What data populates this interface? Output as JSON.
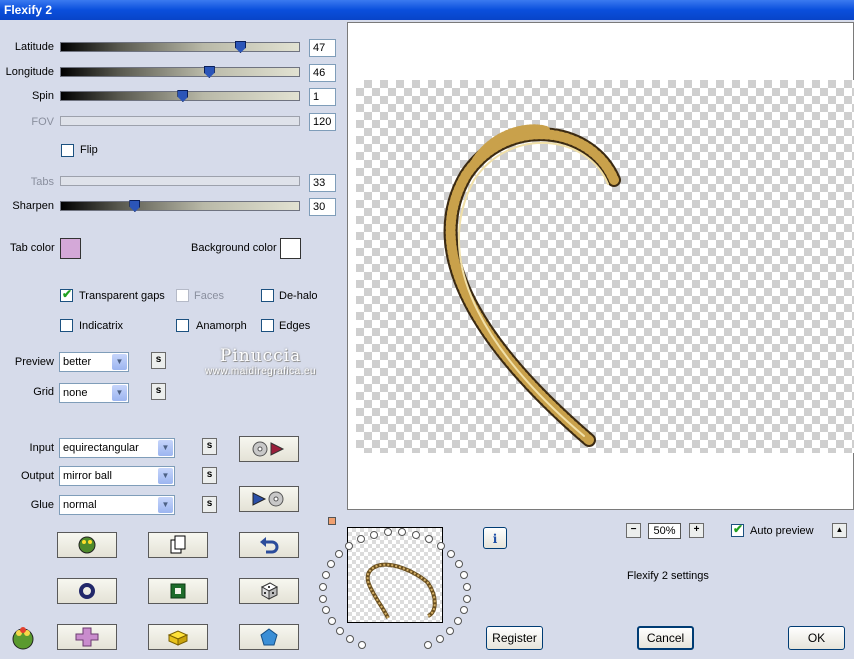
{
  "window": {
    "title": "Flexify 2"
  },
  "sliders": [
    {
      "label": "Latitude",
      "value": "47",
      "fraction": 0.75,
      "enabled": true
    },
    {
      "label": "Longitude",
      "value": "46",
      "fraction": 0.62,
      "enabled": true
    },
    {
      "label": "Spin",
      "value": "1",
      "fraction": 0.51,
      "enabled": true
    },
    {
      "label": "FOV",
      "value": "120",
      "enabled": false
    },
    {
      "label": "Tabs",
      "value": "33",
      "enabled": false
    },
    {
      "label": "Sharpen",
      "value": "30",
      "fraction": 0.31,
      "enabled": true
    }
  ],
  "flip": {
    "label": "Flip",
    "checked": false
  },
  "colors": {
    "tab_color_label": "Tab color",
    "tab_color": "#d4a8d8",
    "background_color_label": "Background color",
    "background_color": "#ffffff"
  },
  "options": {
    "transparent_gaps": {
      "label": "Transparent gaps",
      "checked": true
    },
    "faces": {
      "label": "Faces",
      "checked": false,
      "enabled": false
    },
    "de_halo": {
      "label": "De-halo",
      "checked": false
    },
    "indicatrix": {
      "label": "Indicatrix",
      "checked": false
    },
    "anamorph": {
      "label": "Anamorph",
      "checked": false
    },
    "edges": {
      "label": "Edges",
      "checked": false
    }
  },
  "preview_quality": {
    "label": "Preview",
    "value": "better"
  },
  "grid": {
    "label": "Grid",
    "value": "none"
  },
  "input": {
    "label": "Input",
    "value": "equirectangular"
  },
  "output": {
    "label": "Output",
    "value": "mirror ball"
  },
  "glue": {
    "label": "Glue",
    "value": "normal"
  },
  "small_button_glyph": "s",
  "watermark": {
    "line1": "Pinuccia",
    "line2": "www.maidiregrafica.eu"
  },
  "zoom": {
    "value": "50%",
    "minus": "−",
    "plus": "+"
  },
  "auto_preview": {
    "label": "Auto preview",
    "checked": true
  },
  "info_glyph": "i",
  "collapse_glyph": "▲",
  "settings_name": "Flexify 2 settings",
  "buttons": {
    "register": "Register",
    "cancel": "Cancel",
    "ok": "OK"
  },
  "accent": {
    "title_bar": "#0a4fdc",
    "dialog_bg": "#d6dbea",
    "slider_thumb": "#2b55b8"
  }
}
